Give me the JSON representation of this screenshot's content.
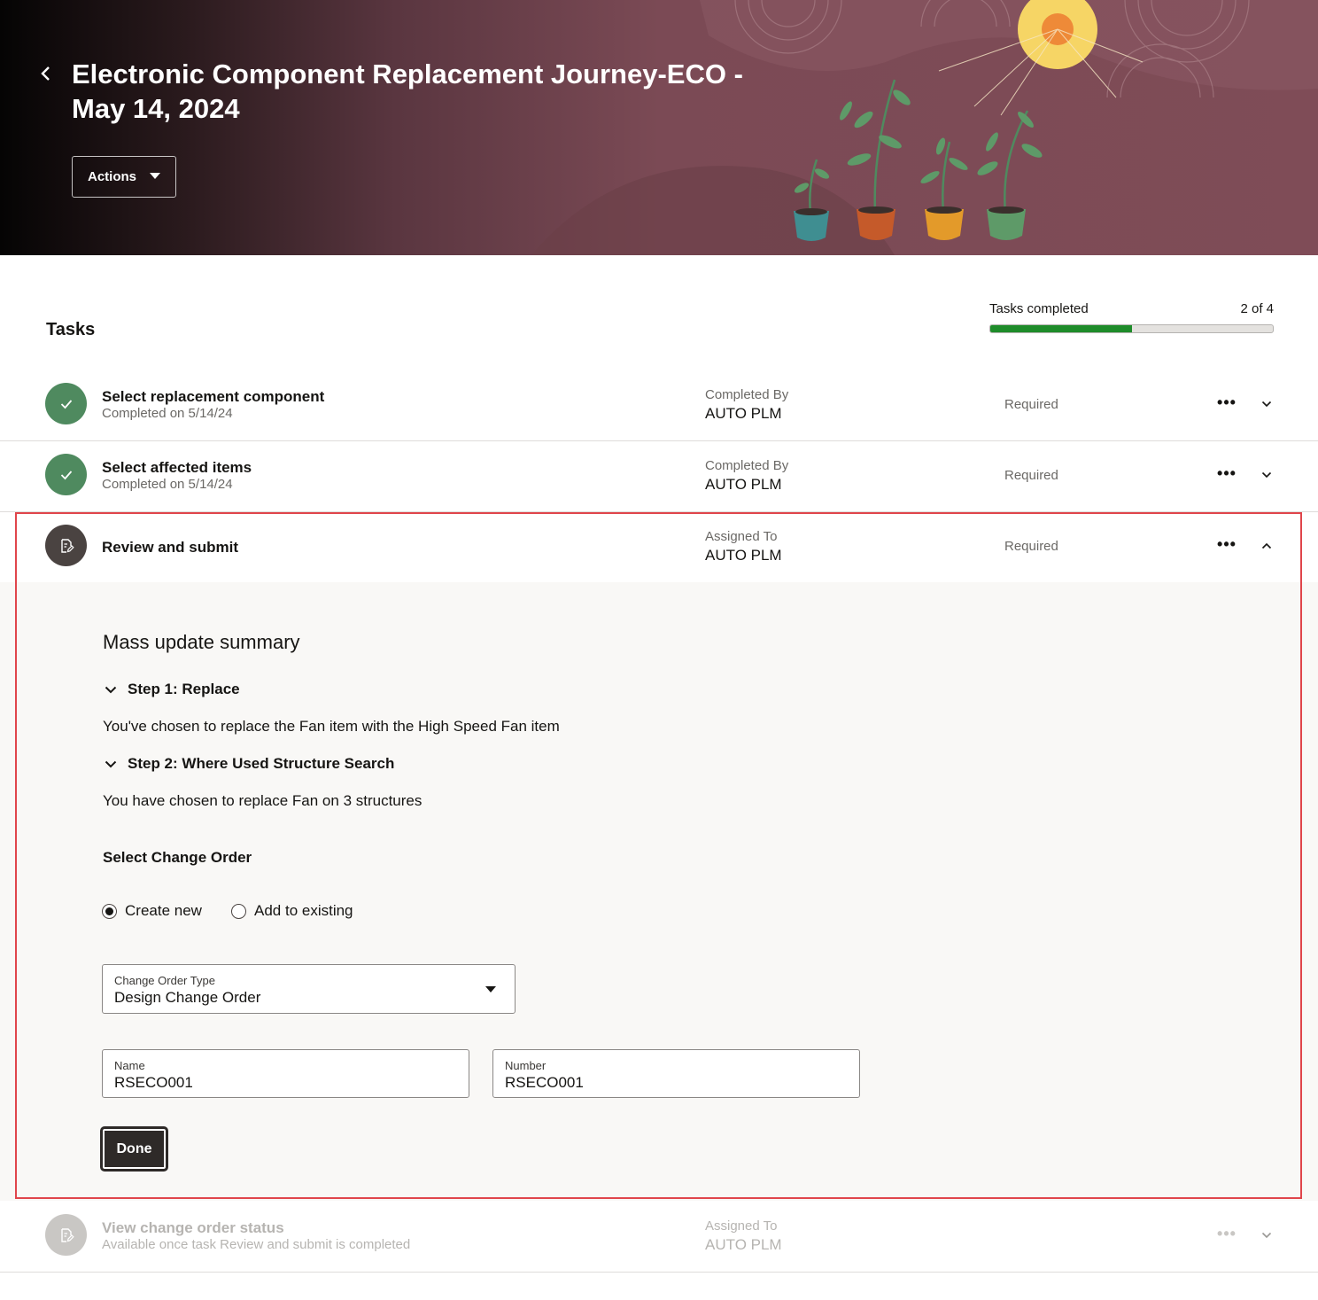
{
  "header": {
    "title": "Electronic Component Replacement Journey-ECO - May 14, 2024",
    "actions_label": "Actions"
  },
  "tasks": {
    "heading": "Tasks",
    "progress_label": "Tasks completed",
    "progress_count": "2 of 4",
    "progress_fraction": 0.5,
    "items": [
      {
        "title": "Select replacement component",
        "subtitle": "Completed on 5/14/24",
        "assign_label": "Completed By",
        "assign_value": "AUTO PLM",
        "required": "Required",
        "more": "•••",
        "status": "completed"
      },
      {
        "title": "Select affected items",
        "subtitle": "Completed on 5/14/24",
        "assign_label": "Completed By",
        "assign_value": "AUTO PLM",
        "required": "Required",
        "more": "•••",
        "status": "completed"
      },
      {
        "title": "Review and submit",
        "subtitle": "",
        "assign_label": "Assigned To",
        "assign_value": "AUTO PLM",
        "required": "Required",
        "more": "•••",
        "status": "active"
      },
      {
        "title": "View change order status",
        "subtitle": "Available once task Review and submit is completed",
        "assign_label": "Assigned To",
        "assign_value": "AUTO PLM",
        "required": "",
        "more": "•••",
        "status": "disabled"
      }
    ]
  },
  "review": {
    "title": "Mass update summary",
    "step1_label": "Step 1: Replace",
    "step1_text": "You've chosen to replace the Fan item with the High Speed Fan item",
    "step2_label": "Step 2: Where Used Structure Search",
    "step2_text": "You have chosen to replace Fan on 3 structures",
    "select_change_order": "Select Change Order",
    "radio_create": "Create new",
    "radio_existing": "Add to existing",
    "selected_option": "Create new",
    "type_label": "Change Order Type",
    "type_value": "Design Change Order",
    "name_label": "Name",
    "name_value": "RSECO001",
    "number_label": "Number",
    "number_value": "RSECO001",
    "done_label": "Done"
  },
  "colors": {
    "accent_green": "#1e8c2a",
    "completed_icon": "#4f8a5f",
    "highlight_border": "#e0454b",
    "banner": "#7f4c57"
  },
  "icons": {
    "back": "chevron-left-icon",
    "check": "check-icon",
    "task": "document-edit-icon",
    "more": "more-horizontal-icon",
    "expand": "chevron-down-icon",
    "collapse": "chevron-up-icon"
  }
}
